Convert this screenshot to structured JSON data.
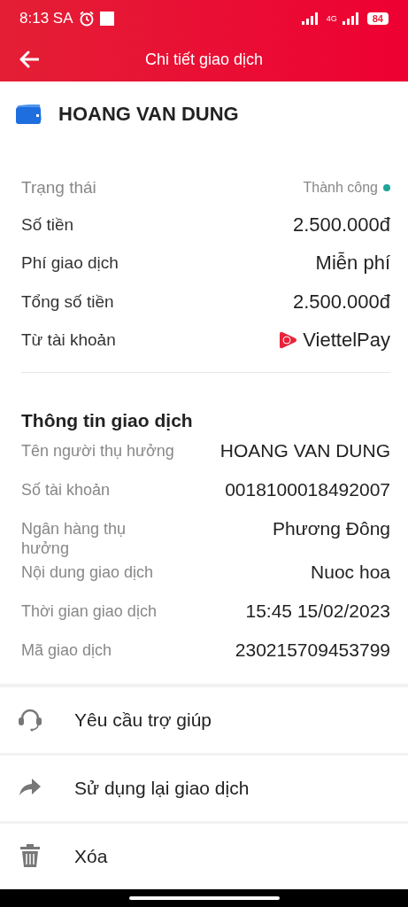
{
  "status_bar": {
    "time": "8:13 SA",
    "network": "4G",
    "battery": "84"
  },
  "header": {
    "title": "Chi tiết giao dịch"
  },
  "recipient": {
    "name": "HOANG VAN DUNG"
  },
  "summary": [
    {
      "kind": "status",
      "label": "Trạng thái",
      "value": "Thành công",
      "color": "#1fa59a"
    },
    {
      "kind": "plain",
      "label": "Số tiền",
      "value": "2.500.000đ"
    },
    {
      "kind": "plain",
      "label": "Phí giao dịch",
      "value": "Miễn phí"
    },
    {
      "kind": "plain",
      "label": "Tổng số tiền",
      "value": "2.500.000đ"
    },
    {
      "kind": "wallet",
      "label": "Từ tài khoản",
      "value": "ViettelPay"
    }
  ],
  "details": {
    "title": "Thông tin giao dịch",
    "rows": [
      {
        "label": "Tên người thụ hưởng",
        "value": "HOANG VAN DUNG"
      },
      {
        "label": "Số tài khoản",
        "value": "0018100018492007"
      },
      {
        "label": "Ngân hàng thụ hưởng",
        "value": "Phương Đông"
      },
      {
        "label": "Nội dung giao dịch",
        "value": "Nuoc hoa"
      },
      {
        "label": "Thời gian giao dịch",
        "value": "15:45 15/02/2023"
      },
      {
        "label": "Mã giao dịch",
        "value": "230215709453799"
      }
    ]
  },
  "actions": [
    {
      "kind": "headset",
      "label": "Yêu cầu trợ giúp"
    },
    {
      "kind": "share",
      "label": "Sử dụng lại giao dịch"
    },
    {
      "kind": "trash",
      "label": "Xóa"
    }
  ]
}
